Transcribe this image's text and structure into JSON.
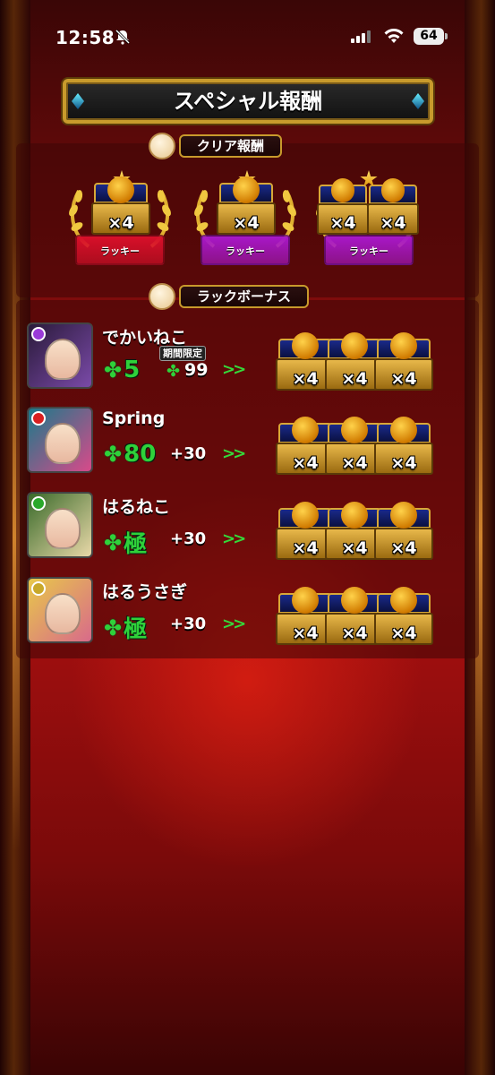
{
  "status_bar": {
    "time": "12:58",
    "battery": "64"
  },
  "title": "スペシャル報酬",
  "clear_reward": {
    "header": "クリア報酬",
    "badges": [
      {
        "quantity": "×4",
        "ribbon": "ラッキー",
        "ribbon_color": "#d8102a",
        "chests": 1
      },
      {
        "quantity": "×4",
        "ribbon": "ラッキー",
        "ribbon_color": "#a818c8",
        "chests": 1
      },
      {
        "quantity": "×4",
        "quantity_2": "×4",
        "ribbon": "ラッキー",
        "ribbon_color": "#a818c8",
        "chests": 2
      }
    ]
  },
  "luck_bonus": {
    "header": "ラックボーナス",
    "rows": [
      {
        "name": "でかいねこ",
        "luck": "5",
        "limited_label": "期間限定",
        "limited_value": "99",
        "arrows": ">>",
        "chests": [
          "×4",
          "×4",
          "×4"
        ],
        "avatar_colors": [
          "#2a1a3a",
          "#7a4aa8"
        ],
        "orb_color": "#9a3ad8"
      },
      {
        "name": "Spring",
        "luck": "80",
        "plus": "+30",
        "arrows": ">>",
        "chests": [
          "×4",
          "×4",
          "×4"
        ],
        "avatar_colors": [
          "#1a7a8a",
          "#d84a8a"
        ],
        "orb_color": "#d82020"
      },
      {
        "name": "はるねこ",
        "luck": "極",
        "plus": "+30",
        "arrows": ">>",
        "chests": [
          "×4",
          "×4",
          "×4"
        ],
        "avatar_colors": [
          "#3a6a2a",
          "#e8d8a8"
        ],
        "orb_color": "#2aa82a"
      },
      {
        "name": "はるうさぎ",
        "luck": "極",
        "plus": "+30",
        "arrows": ">>",
        "chests": [
          "×4",
          "×4",
          "×4"
        ],
        "avatar_colors": [
          "#e8c84a",
          "#d86a8a"
        ],
        "orb_color": "#c8a82a"
      }
    ]
  },
  "colors": {
    "gold_border": "#c89a2c",
    "luck_green": "#2fd13a"
  }
}
